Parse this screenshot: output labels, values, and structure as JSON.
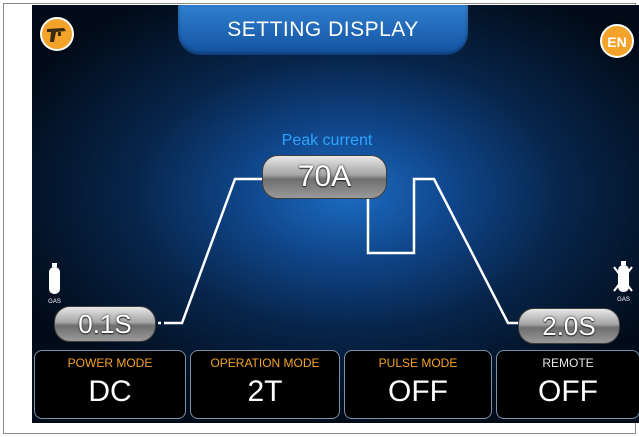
{
  "header": {
    "title": "SETTING DISPLAY",
    "language_label": "EN",
    "gun_icon": "welding-gun-icon"
  },
  "waveform": {
    "peak_label": "Peak current",
    "peak_value": "70A",
    "pre_gas_value": "0.1S",
    "post_gas_value": "2.0S",
    "pre_gas_icon": "gas-cylinder-icon",
    "post_gas_icon": "gas-off-icon",
    "gas_text": "GAS"
  },
  "modes": [
    {
      "label": "POWER MODE",
      "value": "DC"
    },
    {
      "label": "OPERATION MODE",
      "value": "2T"
    },
    {
      "label": "PULSE MODE",
      "value": "OFF"
    },
    {
      "label": "REMOTE",
      "value": "OFF"
    }
  ],
  "colors": {
    "accent": "#f3a32a",
    "peak_label": "#2fa4ff",
    "title_bar": "#1f66b6",
    "mode_label": "#f3a32a",
    "remote_label": "#e8e8e8"
  }
}
